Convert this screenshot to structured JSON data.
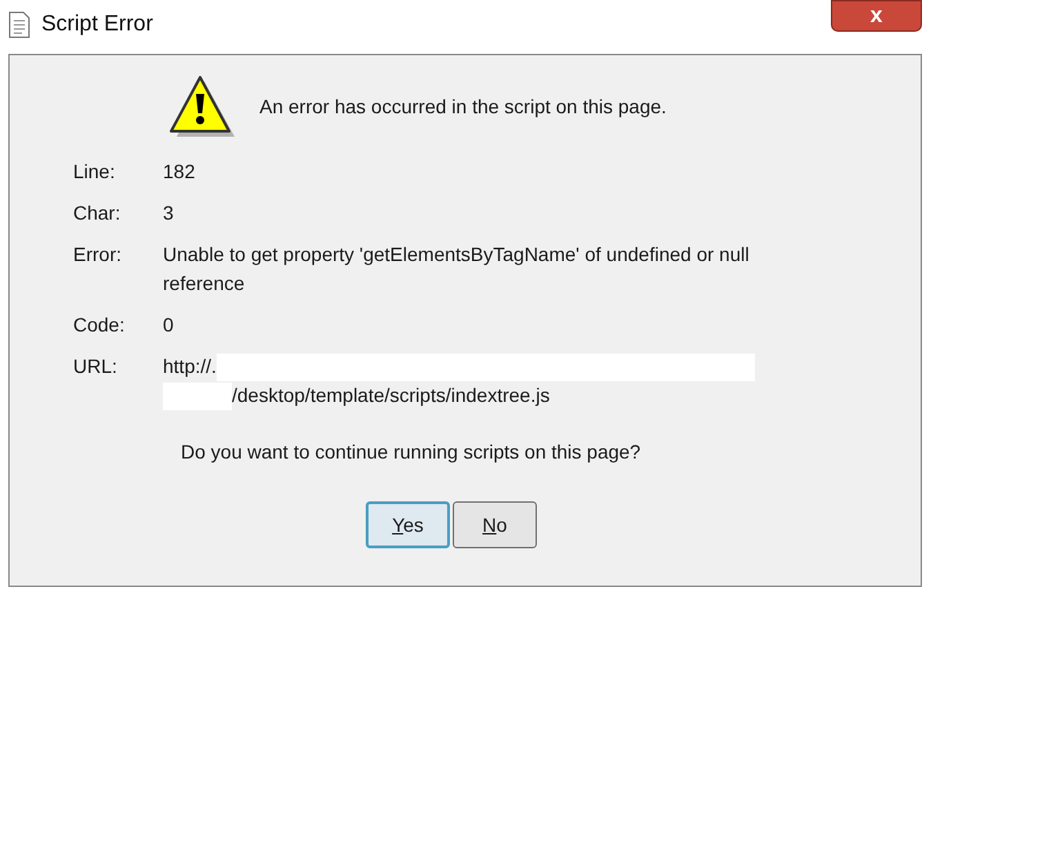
{
  "window": {
    "title": "Script Error",
    "close_label": "x"
  },
  "message": "An error has occurred in the script on this page.",
  "details": [
    {
      "label": "Line:",
      "value": "182"
    },
    {
      "label": "Char:",
      "value": "3"
    },
    {
      "label": "Error:",
      "value": "Unable to get property 'getElementsByTagName' of undefined or null reference"
    },
    {
      "label": "Code:",
      "value": "0"
    },
    {
      "label": "URL:",
      "value": "http://.",
      "value_line_2": "/desktop/template/scripts/indextree.js",
      "redacted": true
    }
  ],
  "question": "Do you want to continue running scripts on this page?",
  "buttons": [
    {
      "label": "Yes",
      "selected": true
    },
    {
      "label": "No",
      "selected": false
    }
  ]
}
